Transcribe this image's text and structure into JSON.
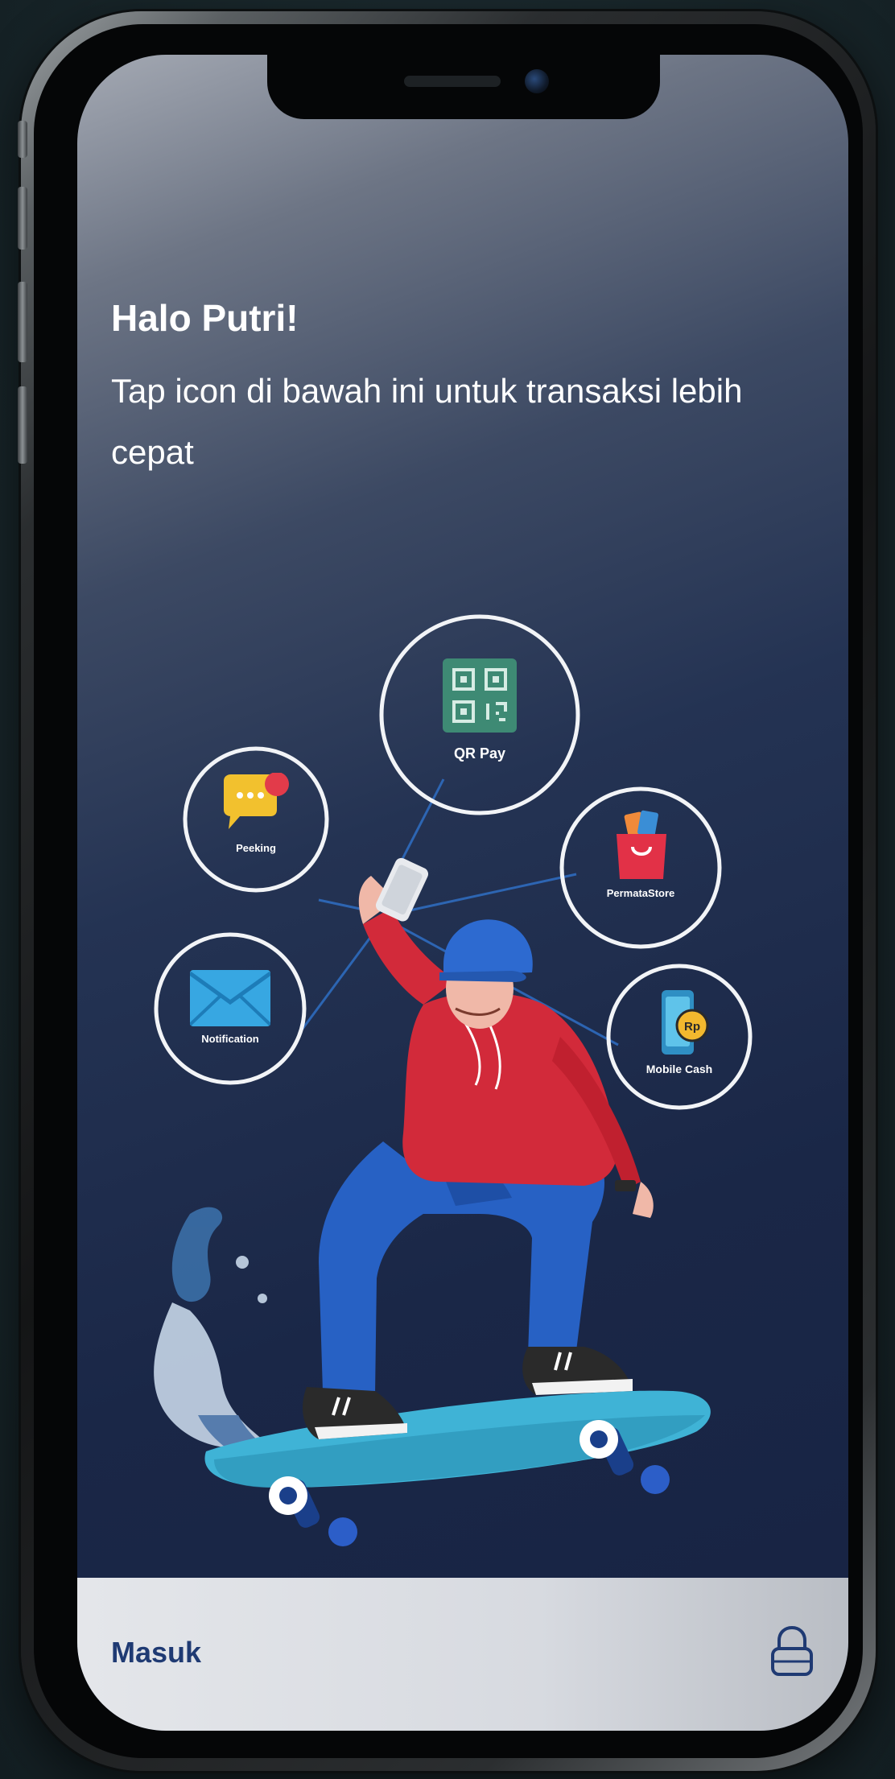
{
  "greeting": {
    "title": "Halo Putri!",
    "subtitle": "Tap icon di bawah ini untuk transaksi lebih cepat"
  },
  "shortcuts": [
    {
      "label": "QR Pay",
      "icon": "qr-code-icon"
    },
    {
      "label": "Peeking",
      "icon": "chat-bubble-icon"
    },
    {
      "label": "PermataStore",
      "icon": "shopping-bag-icon"
    },
    {
      "label": "Notification",
      "icon": "envelope-icon"
    },
    {
      "label": "Mobile Cash",
      "icon": "phone-coin-icon"
    }
  ],
  "bottom_bar": {
    "login_label": "Masuk",
    "lock_icon": "lock-icon"
  },
  "colors": {
    "accent": "#1f3a73",
    "screen_bg": "#1a2747",
    "hoodie": "#d22a3a",
    "skateboard": "#3fb3d6"
  }
}
